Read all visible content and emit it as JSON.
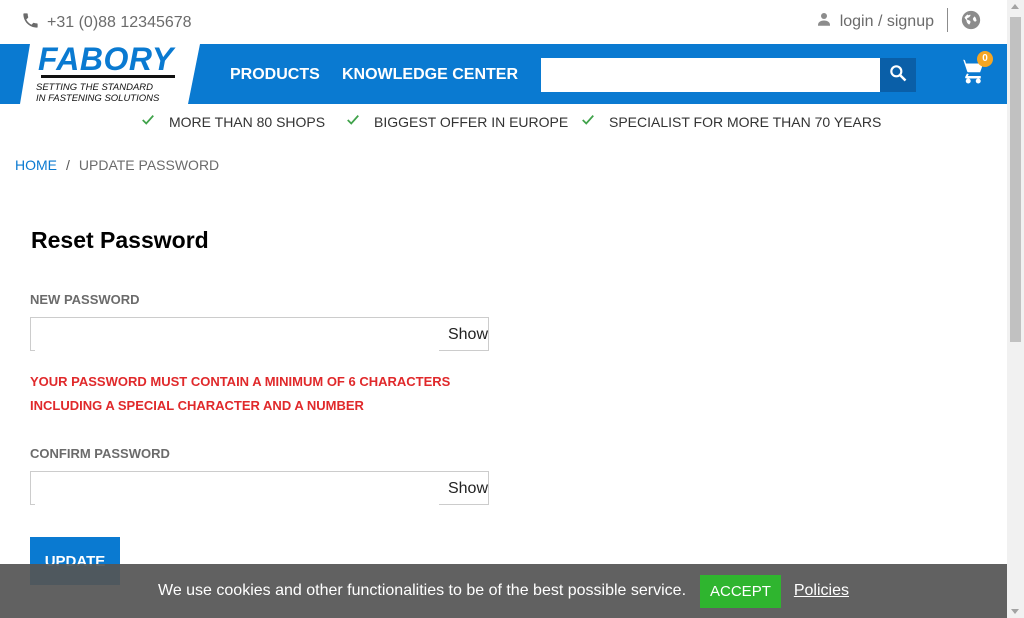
{
  "topbar": {
    "phone": "+31 (0)88 12345678",
    "login": "login / signup"
  },
  "logo": {
    "name": "FABORY",
    "tagline_1": "SETTING THE STANDARD",
    "tagline_2": "IN FASTENING SOLUTIONS"
  },
  "nav": {
    "products": "PRODUCTS",
    "knowledge": "KNOWLEDGE CENTER"
  },
  "search": {
    "value": "",
    "placeholder": ""
  },
  "cart": {
    "count": "0"
  },
  "usp": [
    "MORE THAN 80 SHOPS",
    "BIGGEST OFFER IN EUROPE",
    "SPECIALIST FOR MORE THAN 70 YEARS"
  ],
  "breadcrumb": {
    "home": "HOME",
    "separator": "/",
    "current": "UPDATE PASSWORD"
  },
  "form": {
    "title": "Reset Password",
    "new_label": "NEW PASSWORD",
    "confirm_label": "CONFIRM PASSWORD",
    "show": "Show",
    "hint_1": "YOUR PASSWORD MUST CONTAIN A MINIMUM OF 6 CHARACTERS",
    "hint_2": "INCLUDING A SPECIAL CHARACTER AND A NUMBER",
    "update": "UPDATE"
  },
  "cookie": {
    "text": "We use cookies and other functionalities to be of the best possible service.",
    "accept": "ACCEPT",
    "policies": "Policies"
  },
  "colors": {
    "brand_blue": "#0a7ad1",
    "error_red": "#e0292b",
    "accept_green": "#2fb52f",
    "badge_orange": "#f5a623"
  },
  "icons": [
    "phone-icon",
    "user-icon",
    "globe-icon",
    "search-icon",
    "cart-icon",
    "check-icon"
  ]
}
